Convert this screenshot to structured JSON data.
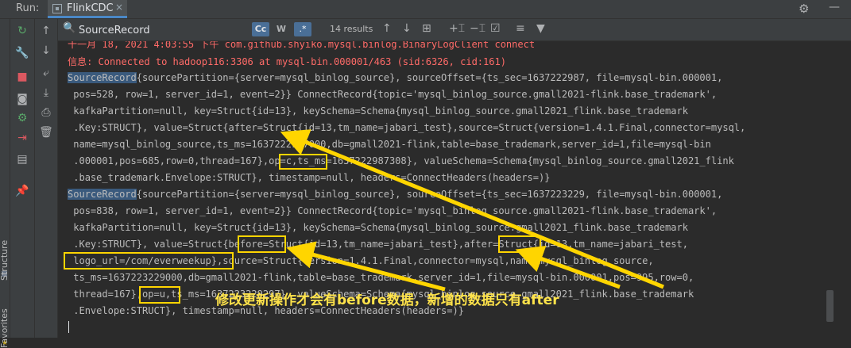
{
  "header": {
    "run_label": "Run:",
    "tab_title": "FlinkCDC",
    "close_glyph": "×",
    "gear_glyph": "⚙",
    "minimize_glyph": "—"
  },
  "side_tabs": {
    "structure": "Structure",
    "favorites": "Favorites"
  },
  "search": {
    "query": "SourceRecord",
    "results": "14 results",
    "match_case": "Cc",
    "words": "W",
    "regex": ".*"
  },
  "console_lines": [
    {
      "text": "十一月 18, 2021 4:03:55 下午 com.github.shyiko.mysql.binlog.BinaryLogClient connect",
      "type": "red"
    },
    {
      "text": "信息: Connected to hadoop116:3306 at mysql-bin.000001/463 (sid:6326, cid:161)",
      "type": "red"
    },
    {
      "hl": "SourceRecord",
      "rest": "{sourcePartition={server=mysql_binlog_source}, sourceOffset={ts_sec=1637222987, file=mysql-bin.000001,",
      "type": "record"
    },
    {
      "text": " pos=528, row=1, server_id=1, event=2}} ConnectRecord{topic='mysql_binlog_source.gmall2021-flink.base_trademark',",
      "type": "normal"
    },
    {
      "text": " kafkaPartition=null, key=Struct{id=13}, keySchema=Schema{mysql_binlog_source.gmall2021_flink.base_trademark",
      "type": "normal"
    },
    {
      "text": " .Key:STRUCT}, value=Struct{after=Struct{id=13,tm_name=jabari_test},source=Struct{version=1.4.1.Final,connector=mysql,",
      "type": "normal"
    },
    {
      "text": " name=mysql_binlog_source,ts_ms=1637222987000,db=gmall2021-flink,table=base_trademark,server_id=1,file=mysql-bin",
      "type": "normal"
    },
    {
      "text": " .000001,pos=685,row=0,thread=167},op=c,ts_ms=1637222987308}, valueSchema=Schema{mysql_binlog_source.gmall2021_flink",
      "type": "normal"
    },
    {
      "text": " .base_trademark.Envelope:STRUCT}, timestamp=null, headers=ConnectHeaders(headers=)}",
      "type": "normal"
    },
    {
      "hl": "SourceRecord",
      "rest": "{sourcePartition={server=mysql_binlog_source}, sourceOffset={ts_sec=1637223229, file=mysql-bin.000001,",
      "type": "record"
    },
    {
      "text": " pos=838, row=1, server_id=1, event=2}} ConnectRecord{topic='mysql_binlog_source.gmall2021-flink.base_trademark',",
      "type": "normal"
    },
    {
      "text": " kafkaPartition=null, key=Struct{id=13}, keySchema=Schema{mysql_binlog_source.gmall2021_flink.base_trademark",
      "type": "normal"
    },
    {
      "text": " .Key:STRUCT}, value=Struct{before=Struct{id=13,tm_name=jabari_test},after=Struct{id=13,tm_name=jabari_test,",
      "type": "normal"
    },
    {
      "text": " logo_url=/com/everweekup},source=Struct{version=1.4.1.Final,connector=mysql,name=mysql_binlog_source,",
      "type": "normal"
    },
    {
      "text": " ts_ms=1637223229000,db=gmall2021-flink,table=base_trademark,server_id=1,file=mysql-bin.000001,pos=995,row=0,",
      "type": "normal"
    },
    {
      "text": " thread=167},op=u,ts_ms=1637223229297}, valueSchema=Schema{mysql_binlog_source.gmall2021_flink.base_trademark",
      "type": "normal"
    },
    {
      "text": " .Envelope:STRUCT}, timestamp=null, headers=ConnectHeaders(headers=)}",
      "type": "normal"
    }
  ],
  "annotation": "修改更新操作才会有before数据，新增的数据只有after",
  "colors": {
    "highlight_box": "#ffd500",
    "annotation_text": "#ffe34a",
    "error_text": "#ff6b68",
    "search_match_bg": "#3a5a7d"
  }
}
